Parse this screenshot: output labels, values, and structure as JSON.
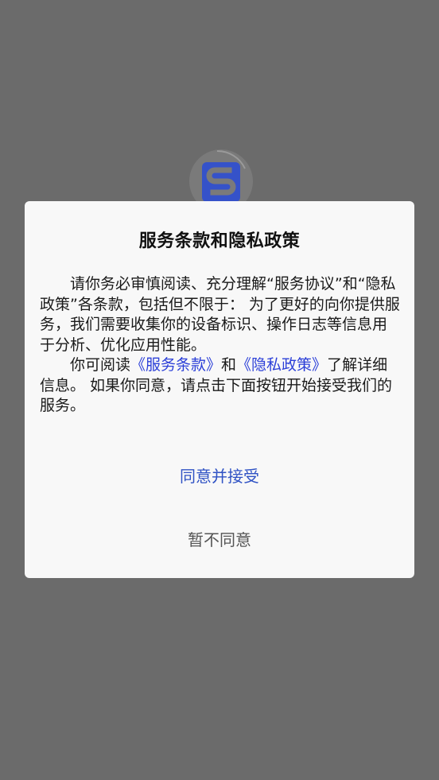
{
  "dialog": {
    "title": "服务条款和隐私政策",
    "paragraph1": "请你务必审慎阅读、充分理解“服务协议”和“隐私政策”各条款，包括但不限于： 为了更好的向你提供服务，我们需要收集你的设备标识、操作日志等信息用于分析、优化应用性能。",
    "paragraph2_prefix": "你可阅读",
    "terms_link": "《服务条款》",
    "paragraph2_and": "和",
    "privacy_link": "《隐私政策》",
    "paragraph2_suffix": "了解详细信息。 如果你同意，请点击下面按钮开始接受我们的服务。",
    "agree_button": "同意并接受",
    "decline_button": "暂不同意"
  },
  "colors": {
    "overlay": "#6b6b6b",
    "link": "#2b3fd8",
    "agree": "#2f52c4",
    "decline": "#555555",
    "logo_blue": "#3552c9"
  },
  "icons": {
    "logo": "app-logo-s-icon",
    "loading": "loading-spinner-icon"
  }
}
